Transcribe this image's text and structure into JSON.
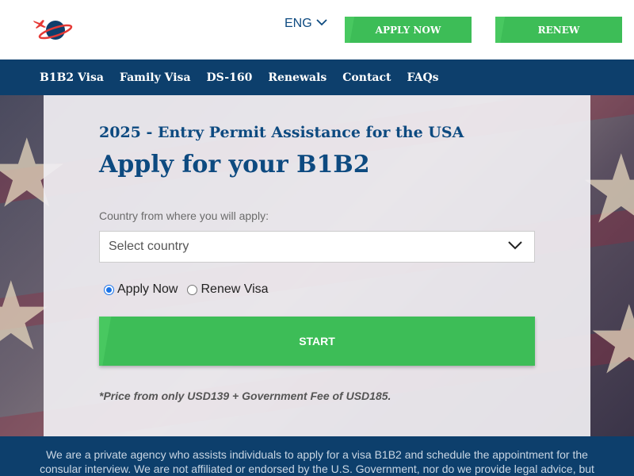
{
  "header": {
    "language": "ENG",
    "apply_now_label": "APPLY NOW",
    "renew_label": "RENEW"
  },
  "nav": {
    "items": [
      {
        "label": "B1B2 Visa"
      },
      {
        "label": "Family Visa"
      },
      {
        "label": "DS-160"
      },
      {
        "label": "Renewals"
      },
      {
        "label": "Contact"
      },
      {
        "label": "FAQs"
      }
    ]
  },
  "form": {
    "subtitle": "2025 - Entry Permit Assistance for the USA",
    "title": "Apply for your B1B2",
    "country_label": "Country from where you will apply:",
    "country_placeholder": "Select country",
    "radio_apply": "Apply Now",
    "radio_renew": "Renew Visa",
    "selected_option": "Apply Now",
    "start_label": "START",
    "price_note": "*Price from only USD139 + Government Fee of USD185."
  },
  "footer": {
    "disclaimer": "We are a private agency who assists individuals to apply for a visa B1B2 and schedule the appointment for the consular interview. We are not affiliated or endorsed by the U.S. Government, nor do we provide legal advice, but we"
  },
  "colors": {
    "brand_blue": "#0d4a80",
    "nav_blue": "#0d3f6c",
    "accent_green": "#3dbd57"
  },
  "icons": {
    "logo": "globe-plane-logo",
    "language_dropdown": "chevron-down-icon",
    "select_dropdown": "chevron-down-icon"
  }
}
